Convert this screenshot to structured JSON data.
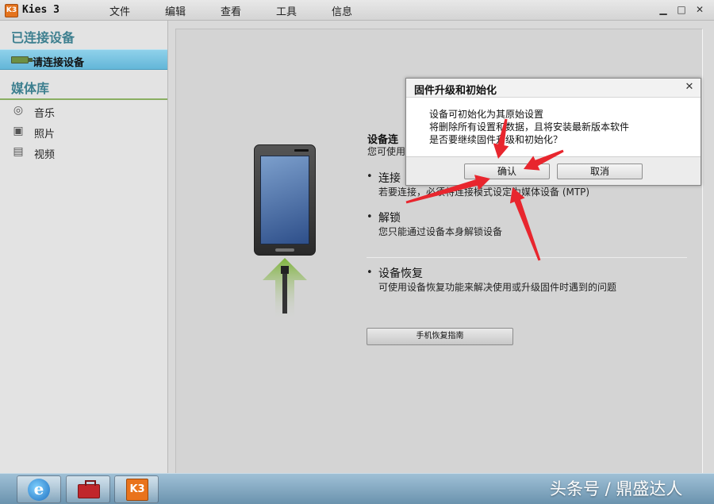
{
  "window": {
    "logo_text": "K3",
    "title": "Kies 3",
    "menu": [
      "文件",
      "编辑",
      "查看",
      "工具",
      "信息"
    ],
    "controls": {
      "minimize": "▁",
      "maximize": "□",
      "close": "✕"
    }
  },
  "sidebar": {
    "connected_title": "已连接设备",
    "device_label": "请连接设备",
    "library_title": "媒体库",
    "library_items": [
      {
        "icon": "music-icon",
        "label": "音乐"
      },
      {
        "icon": "photo-icon",
        "label": "照片"
      },
      {
        "icon": "video-icon",
        "label": "视频"
      }
    ]
  },
  "main": {
    "heading": "设备连",
    "subheading": "您可使用",
    "items": [
      {
        "title": "连接",
        "desc": "若要连接，必须将连接模式设定为媒体设备 (MTP)"
      },
      {
        "title": "解锁",
        "desc": "您只能通过设备本身解锁设备"
      },
      {
        "title": "设备恢复",
        "desc": "可使用设备恢复功能来解决使用或升级固件时遇到的问题"
      }
    ],
    "guide_button": "手机恢复指南"
  },
  "dialog": {
    "title": "固件升级和初始化",
    "close": "✕",
    "lines": [
      "设备可初始化为其原始设置",
      "将删除所有设置和数据，且将安装最新版本软件",
      "是否要继续固件升级和初始化？"
    ],
    "confirm": "确认",
    "cancel": "取消"
  },
  "annotation": {
    "arrow_color": "#e8262e"
  },
  "taskbar": {
    "ie_letter": "e",
    "kies_letter": "K3",
    "watermark": "头条号 / 鼎盛达人"
  }
}
